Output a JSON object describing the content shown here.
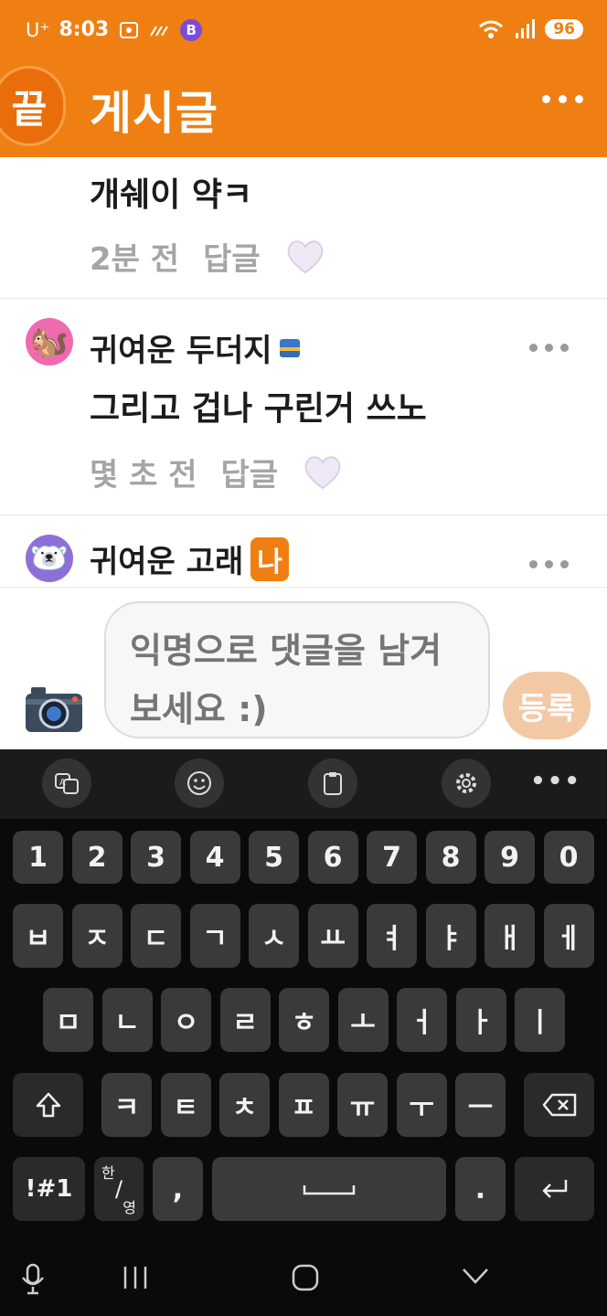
{
  "status_bar": {
    "carrier": "U⁺",
    "time": "8:03",
    "b_badge": "B",
    "battery": "96"
  },
  "header": {
    "logo_text": "끝",
    "title": "게시글"
  },
  "comments": [
    {
      "text": "개쉐이 약ㅋ",
      "time": "2분 전",
      "reply": "답글"
    },
    {
      "avatar": "🐿️",
      "name": "귀여운 두더지",
      "text": "그리고 겁나 구린거 쓰노",
      "time": "몇 초 전",
      "reply": "답글"
    },
    {
      "avatar": "🐻‍❄️",
      "name": "귀여운 고래",
      "me_badge": "나"
    }
  ],
  "input": {
    "placeholder": "익명으로 댓글을 남겨보세요 :)",
    "submit_label": "등록"
  },
  "keyboard": {
    "numbers": [
      "1",
      "2",
      "3",
      "4",
      "5",
      "6",
      "7",
      "8",
      "9",
      "0"
    ],
    "row1": [
      "ㅂ",
      "ㅈ",
      "ㄷ",
      "ㄱ",
      "ㅅ",
      "ㅛ",
      "ㅕ",
      "ㅑ",
      "ㅐ",
      "ㅔ"
    ],
    "row2": [
      "ㅁ",
      "ㄴ",
      "ㅇ",
      "ㄹ",
      "ㅎ",
      "ㅗ",
      "ㅓ",
      "ㅏ",
      "ㅣ"
    ],
    "row3": [
      "ㅋ",
      "ㅌ",
      "ㅊ",
      "ㅍ",
      "ㅠ",
      "ㅜ",
      "ㅡ"
    ],
    "symbols_key": "!#1",
    "lang_key_top": "한",
    "lang_key_bottom": "영",
    "comma_key": ",",
    "period_key": "."
  },
  "colors": {
    "brand": "#ef7f12",
    "submit_disabled": "#f2c9a4",
    "keyboard_bg": "#0a0a0a"
  },
  "icons": [
    "camera-icon",
    "heart-icon",
    "more-icon",
    "shift-icon",
    "backspace-icon",
    "enter-icon",
    "mic-icon",
    "emoji-icon",
    "clipboard-icon",
    "settings-icon",
    "translate-icon"
  ]
}
